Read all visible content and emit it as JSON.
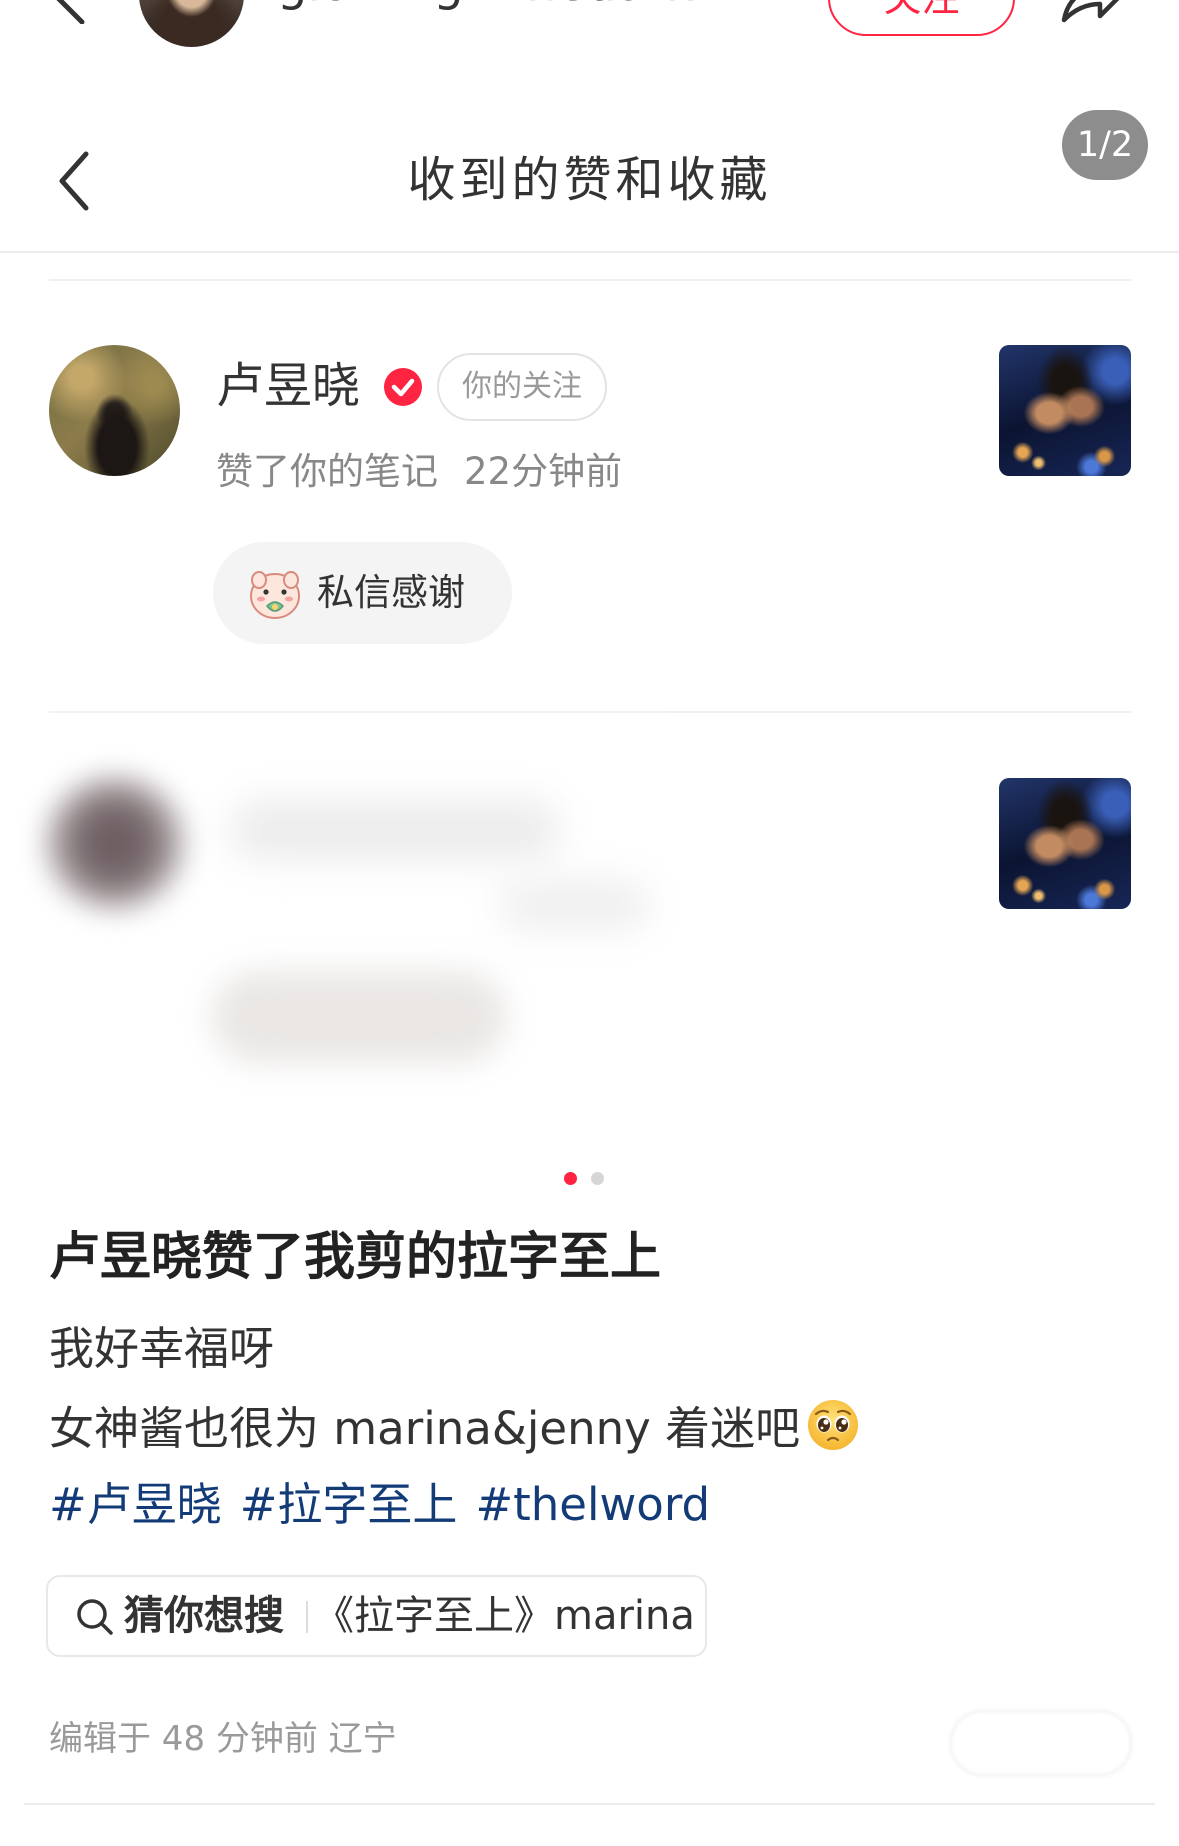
{
  "topbar": {
    "username": "glowinginthedark",
    "follow_label": "关注",
    "back_icon": "chevron-left-icon",
    "share_icon": "share-arrow-icon"
  },
  "sheet": {
    "title": "收到的赞和收藏",
    "page_counter": "1/2",
    "back_icon": "chevron-left-icon"
  },
  "notifications": [
    {
      "name": "卢昱晓",
      "verified": true,
      "badge": "你的关注",
      "action": "赞了你的笔记",
      "time": "22分钟前",
      "dm_label": "私信感谢",
      "dm_icon": "thank-you-sticker-icon"
    },
    {
      "blurred": true
    }
  ],
  "carousel": {
    "current": 1,
    "total": 2
  },
  "note": {
    "title": "卢昱晓赞了我剪的拉字至上",
    "line1": "我好幸福呀",
    "line2": "女神酱也很为 marina&jenny 着迷吧",
    "line2_emoji": "pleading-face",
    "hashtags": [
      "#卢昱晓",
      "#拉字至上",
      "#thelword"
    ]
  },
  "search_suggest": {
    "label": "猜你想搜",
    "query": "《拉字至上》marina",
    "icon": "search-icon"
  },
  "footer": {
    "edited": "编辑于 48 分钟前 辽宁"
  },
  "colors": {
    "accent": "#ff2442",
    "hashtag": "#133b78",
    "text": "#333333",
    "muted": "#999999"
  }
}
